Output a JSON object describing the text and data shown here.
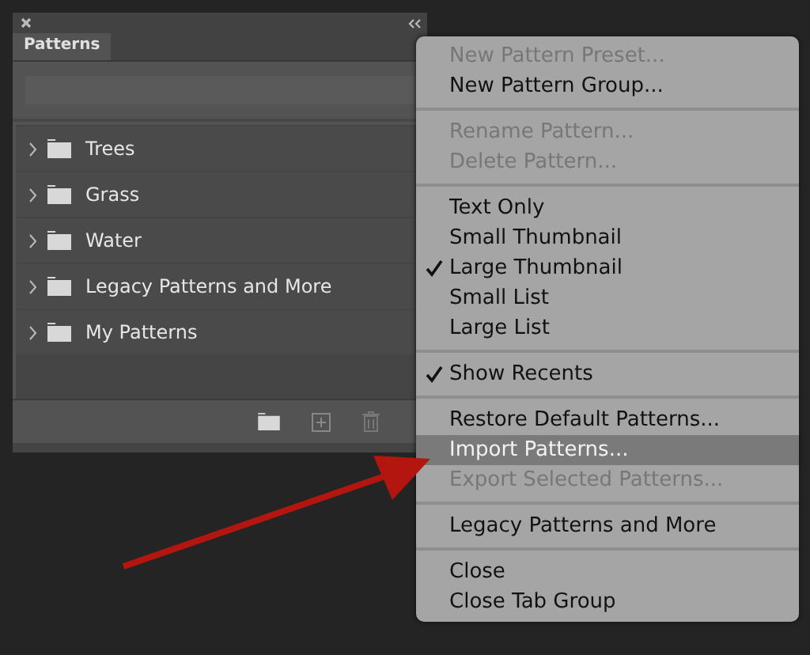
{
  "panel": {
    "tabs": [
      {
        "label": "Patterns",
        "selected": true
      }
    ],
    "groups": [
      {
        "label": "Trees",
        "expanded": false
      },
      {
        "label": "Grass",
        "expanded": false
      },
      {
        "label": "Water",
        "expanded": false
      },
      {
        "label": "Legacy Patterns and More",
        "expanded": false
      },
      {
        "label": "My Patterns",
        "expanded": false
      }
    ]
  },
  "menu": {
    "sections": [
      [
        {
          "label": "New Pattern Preset...",
          "disabled": true,
          "checked": false,
          "selected": false
        },
        {
          "label": "New Pattern Group...",
          "disabled": false,
          "checked": false,
          "selected": false
        }
      ],
      [
        {
          "label": "Rename Pattern...",
          "disabled": true,
          "checked": false,
          "selected": false
        },
        {
          "label": "Delete Pattern...",
          "disabled": true,
          "checked": false,
          "selected": false
        }
      ],
      [
        {
          "label": "Text Only",
          "disabled": false,
          "checked": false,
          "selected": false
        },
        {
          "label": "Small Thumbnail",
          "disabled": false,
          "checked": false,
          "selected": false
        },
        {
          "label": "Large Thumbnail",
          "disabled": false,
          "checked": true,
          "selected": false
        },
        {
          "label": "Small List",
          "disabled": false,
          "checked": false,
          "selected": false
        },
        {
          "label": "Large List",
          "disabled": false,
          "checked": false,
          "selected": false
        }
      ],
      [
        {
          "label": "Show Recents",
          "disabled": false,
          "checked": true,
          "selected": false
        }
      ],
      [
        {
          "label": "Restore Default Patterns...",
          "disabled": false,
          "checked": false,
          "selected": false
        },
        {
          "label": "Import Patterns...",
          "disabled": false,
          "checked": false,
          "selected": true
        },
        {
          "label": "Export Selected Patterns...",
          "disabled": true,
          "checked": false,
          "selected": false
        }
      ],
      [
        {
          "label": "Legacy Patterns and More",
          "disabled": false,
          "checked": false,
          "selected": false
        }
      ],
      [
        {
          "label": "Close",
          "disabled": false,
          "checked": false,
          "selected": false
        },
        {
          "label": "Close Tab Group",
          "disabled": false,
          "checked": false,
          "selected": false
        }
      ]
    ]
  }
}
